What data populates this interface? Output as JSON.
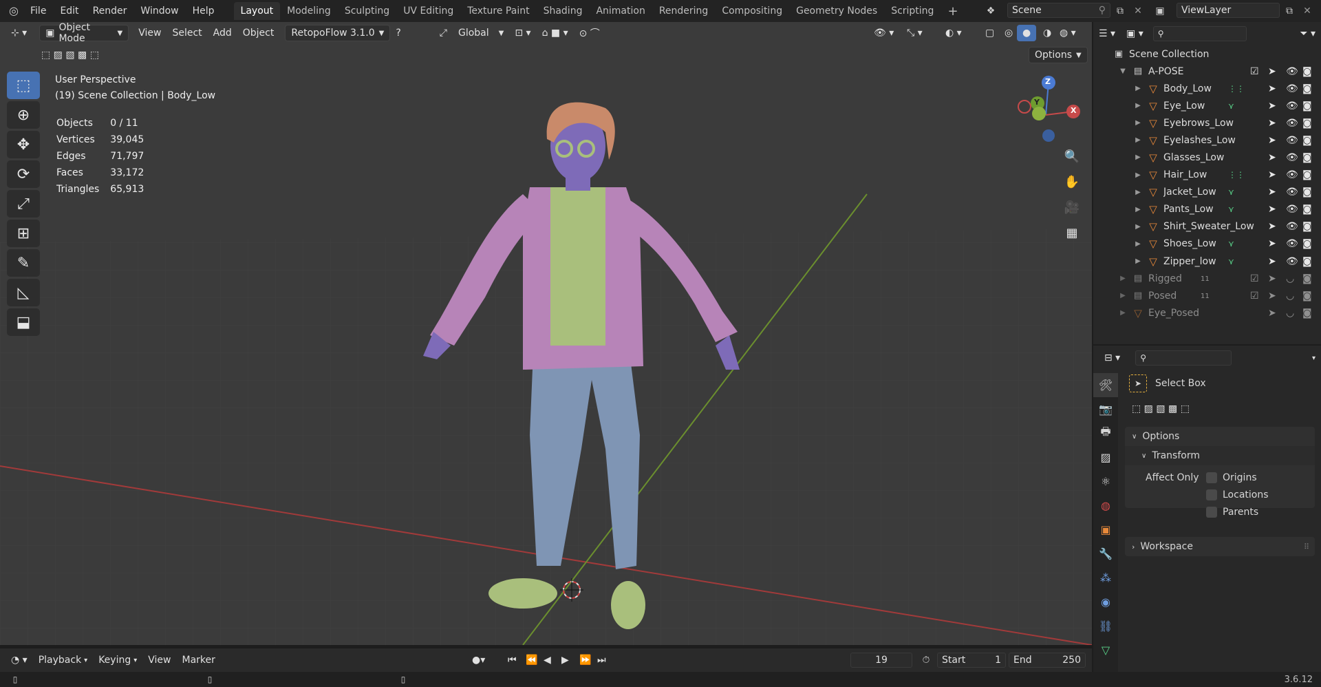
{
  "menu": {
    "items": [
      "File",
      "Edit",
      "Render",
      "Window",
      "Help"
    ]
  },
  "workspaces": {
    "tabs": [
      "Layout",
      "Modeling",
      "Sculpting",
      "UV Editing",
      "Texture Paint",
      "Shading",
      "Animation",
      "Rendering",
      "Compositing",
      "Geometry Nodes",
      "Scripting"
    ],
    "active": "Layout",
    "add": "+"
  },
  "scene": {
    "name": "Scene",
    "view_layer": "ViewLayer"
  },
  "viewport": {
    "mode": "Object Mode",
    "menus": [
      "View",
      "Select",
      "Add",
      "Object"
    ],
    "addon": "RetopoFlow 3.1.0",
    "orientation": "Global",
    "options": "Options",
    "perspective": "User Perspective",
    "collection_line": "(19) Scene Collection | Body_Low",
    "stats": [
      {
        "label": "Objects",
        "value": "0 / 11"
      },
      {
        "label": "Vertices",
        "value": "39,045"
      },
      {
        "label": "Edges",
        "value": "71,797"
      },
      {
        "label": "Faces",
        "value": "33,172"
      },
      {
        "label": "Triangles",
        "value": "65,913"
      }
    ],
    "gizmo": {
      "z": "Z",
      "y": "Y",
      "x": "X"
    },
    "colors": {
      "grid_x": "#a23a3a",
      "grid_y": "#6b8f2e",
      "bg": "#3b3b3b",
      "jacket": "#b784b8",
      "shirt": "#a9bf7c",
      "pants": "#7f95b4",
      "skin": "#7e6bb8",
      "hair": "#c98a6a"
    }
  },
  "timeline": {
    "menus": [
      "Playback",
      "Keying",
      "View",
      "Marker"
    ],
    "current_frame": "19",
    "start_label": "Start",
    "start": "1",
    "end_label": "End",
    "end": "250"
  },
  "status": {
    "version": "3.6.12"
  },
  "outliner": {
    "root": "Scene Collection",
    "collection": "A-POSE",
    "objects": [
      "Body_Low",
      "Eye_Low",
      "Eyebrows_Low",
      "Eyelashes_Low",
      "Glasses_Low",
      "Hair_Low",
      "Jacket_Low",
      "Pants_Low",
      "Shirt_Sweater_Low",
      "Shoes_Low",
      "Zipper_low"
    ],
    "others": [
      {
        "name": "Rigged",
        "count": "11"
      },
      {
        "name": "Posed",
        "count": "11"
      },
      {
        "name": "Eye_Posed",
        "count": ""
      }
    ]
  },
  "properties": {
    "tool": "Select Box",
    "options_label": "Options",
    "transform_label": "Transform",
    "affect_only": "Affect Only",
    "checks": [
      "Origins",
      "Locations",
      "Parents"
    ],
    "workspace_label": "Workspace"
  }
}
